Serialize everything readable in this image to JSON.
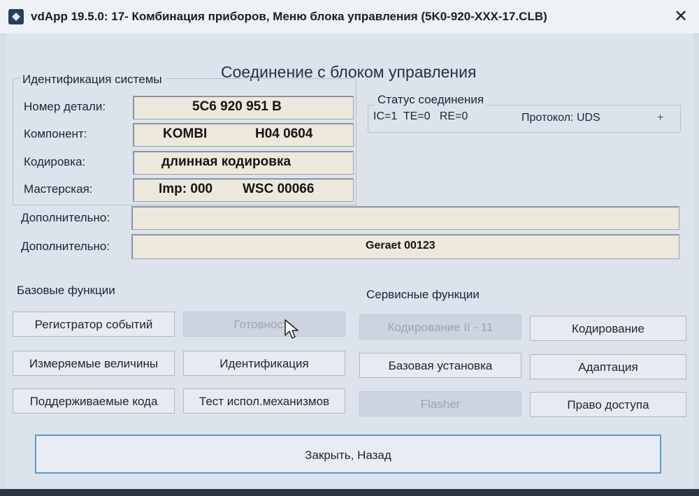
{
  "window": {
    "title": "vdApp 19.5.0: 17- Комбинация приборов,  Меню блока управления (5K0-920-XXX-17.CLB)",
    "close_glyph": "✕"
  },
  "heading": "Соединение с блоком управления",
  "identification": {
    "group_label": "Идентификация системы",
    "rows": [
      {
        "label": "Номер детали:",
        "parts": [
          "5C6 920 951 B"
        ]
      },
      {
        "label": "Компонент:",
        "parts": [
          "KOMBI",
          "H04 0604"
        ]
      },
      {
        "label": "Кодировка:",
        "parts": [
          "длинная кодировка"
        ]
      },
      {
        "label": "Мастерская:",
        "parts": [
          "Imp: 000",
          "WSC 00066"
        ]
      }
    ],
    "extra": [
      {
        "label": "Дополнительно:",
        "value": ""
      },
      {
        "label": "Дополнительно:",
        "value": "Geraet 00123"
      }
    ]
  },
  "status": {
    "group_label": "Статус соединения",
    "line": "IC=1  TE=0   RE=0",
    "protocol": "Протокол: UDS",
    "indicator": "+"
  },
  "basic_functions": {
    "label": "Базовые функции",
    "buttons": [
      {
        "label": "Регистратор событий",
        "enabled": true
      },
      {
        "label": "Готовность",
        "enabled": false
      },
      {
        "label": "Измеряемые величины",
        "enabled": true
      },
      {
        "label": "Идентификация",
        "enabled": true
      },
      {
        "label": "Поддерживаемые кода",
        "enabled": true
      },
      {
        "label": "Тест испол.механизмов",
        "enabled": true
      }
    ]
  },
  "service_functions": {
    "label": "Сервисные функции",
    "buttons": [
      {
        "label": "Кодирование II - 11",
        "enabled": false
      },
      {
        "label": "Кодирование",
        "enabled": true
      },
      {
        "label": "Базовая установка",
        "enabled": true
      },
      {
        "label": "Адаптация",
        "enabled": true
      },
      {
        "label": "Flasher",
        "enabled": false
      },
      {
        "label": "Право доступа",
        "enabled": true
      }
    ]
  },
  "close_back": "Закрыть, Назад",
  "colors": {
    "accent": "#5a9cc9",
    "field_bg": "#ece9dc",
    "disabled_bg": "#cdd4df"
  }
}
